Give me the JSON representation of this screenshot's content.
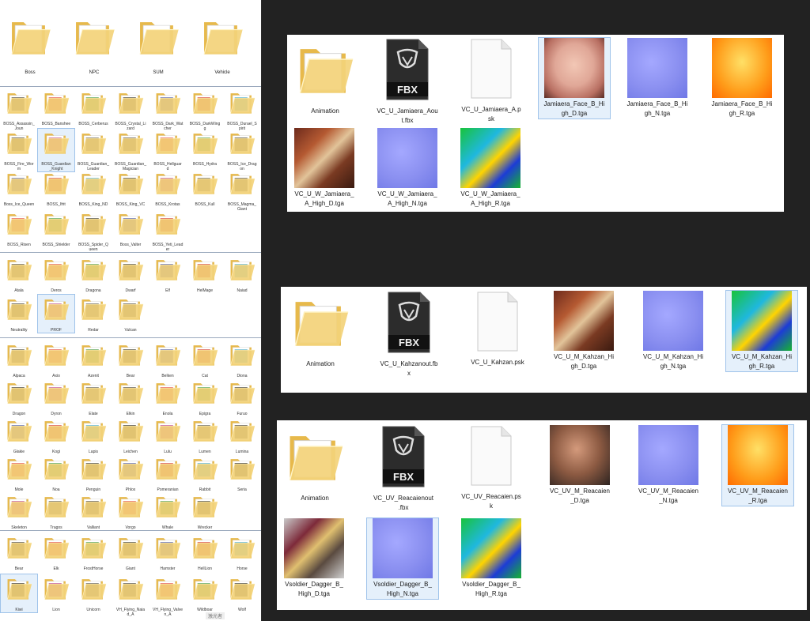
{
  "left": {
    "top_folders": [
      "Boss",
      "NPC",
      "SUM",
      "Vehicle"
    ],
    "boss_items": [
      "BOSS_Assassin_\nJoun",
      "BOSS_Banshee",
      "BOSS_Cerberus",
      "BOSS_Crystal_Li\nzard",
      "BOSS_Dark_Wat\ncher",
      "BOSS_DarkWing\ng",
      "BOSS_Durael_S\npirit",
      "BOSS_Fire_Wor\nm",
      "BOSS_Guardian\n_Knight",
      "BOSS_Guardian_\nLeader",
      "BOSS_Guardian_\nMagician",
      "BOSS_Hellguar\nd",
      "BOSS_Hydra",
      "BOSS_Ice_Drag\non",
      "Boss_Ice_Queen",
      "BOSS_Ifrit",
      "BOSS_King_ND",
      "BOSS_King_VC",
      "BOSS_Krotas",
      "BOSS_Kull",
      "BOSS_Magma_\nGiant",
      "BOSS_Risen",
      "BOSS_Shielder",
      "BOSS_Spider_Q\nueen",
      "Boss_Valter",
      "BOSS_Yeti_Lead\ner"
    ],
    "npc_items": [
      "Atala",
      "Deros",
      "Dragona",
      "Dwarf",
      "Elf",
      "HelMage",
      "Naiad",
      "Neutrality",
      "PROF",
      "Redar",
      "Vulcan"
    ],
    "sum_items": [
      "Alpaca",
      "Axio",
      "Azenit",
      "Bear",
      "Belken",
      "Cat",
      "Diona",
      "Dragon",
      "Dyron",
      "Elate",
      "Elkin",
      "Enola",
      "Epigra",
      "Furuo",
      "Glakie",
      "Kogi",
      "Lapis",
      "Leichen",
      "Lulu",
      "Lumen",
      "Lumina",
      "Mole",
      "Noa",
      "Penguin",
      "Phlox",
      "Pomeranian",
      "Rabbit",
      "Seria",
      "Skeleton",
      "Tragos",
      "Valliant",
      "Vorgo",
      "Whale",
      "Wrecker"
    ],
    "vehicle_items": [
      "Bear",
      "Elk",
      "FrostHorse",
      "Giant",
      "Hamster",
      "HellLion",
      "Horse",
      "Kiwi",
      "Lion",
      "Unicorn",
      "VH_Flying_Naia\nd_A",
      "VH_Flying_Valve\nn_A",
      "Wildboar",
      "Wolf"
    ],
    "watermark": "激光者"
  },
  "panel1": {
    "items": [
      "Animation",
      "VC_U_Jamiaera_Aou\nt.fbx",
      "VC_U_Jamiaera_A.p\nsk",
      "Jamiaera_Face_B_Hi\ngh_D.tga",
      "Jamiaera_Face_B_Hi\ngh_N.tga",
      "Jamiaera_Face_B_Hi\ngh_R.tga",
      "VC_U_W_Jamiaera_\nA_High_D.tga",
      "VC_U_W_Jamiaera_\nA_High_N.tga",
      "VC_U_W_Jamiaera_\nA_High_R.tga"
    ]
  },
  "panel2": {
    "items": [
      "Animation",
      "VC_U_Kahzanout.fb\nx",
      "VC_U_Kahzan.psk",
      "VC_U_M_Kahzan_Hi\ngh_D.tga",
      "VC_U_M_Kahzan_Hi\ngh_N.tga",
      "VC_U_M_Kahzan_Hi\ngh_R.tga"
    ]
  },
  "panel3": {
    "items": [
      "Animation",
      "VC_UV_Reacaienout\n.fbx",
      "VC_UV_Reacaien.ps\nk",
      "VC_UV_M_Reacaien\n_D.tga",
      "VC_UV_M_Reacaien\n_N.tga",
      "VC_UV_M_Reacaien\n_R.tga",
      "Vsoldier_Dagger_B_\nHigh_D.tga",
      "Vsoldier_Dagger_B_\nHigh_N.tga",
      "Vsoldier_Dagger_B_\nHigh_R.tga"
    ]
  },
  "fbx_badge": "FBX",
  "colors": {
    "folder": "#f1cc6b",
    "normal_map": "#8a8ff0",
    "rough_map": "#ff9d1a",
    "id_map": "#1fb8e0",
    "selection": "#9fc3ea"
  }
}
